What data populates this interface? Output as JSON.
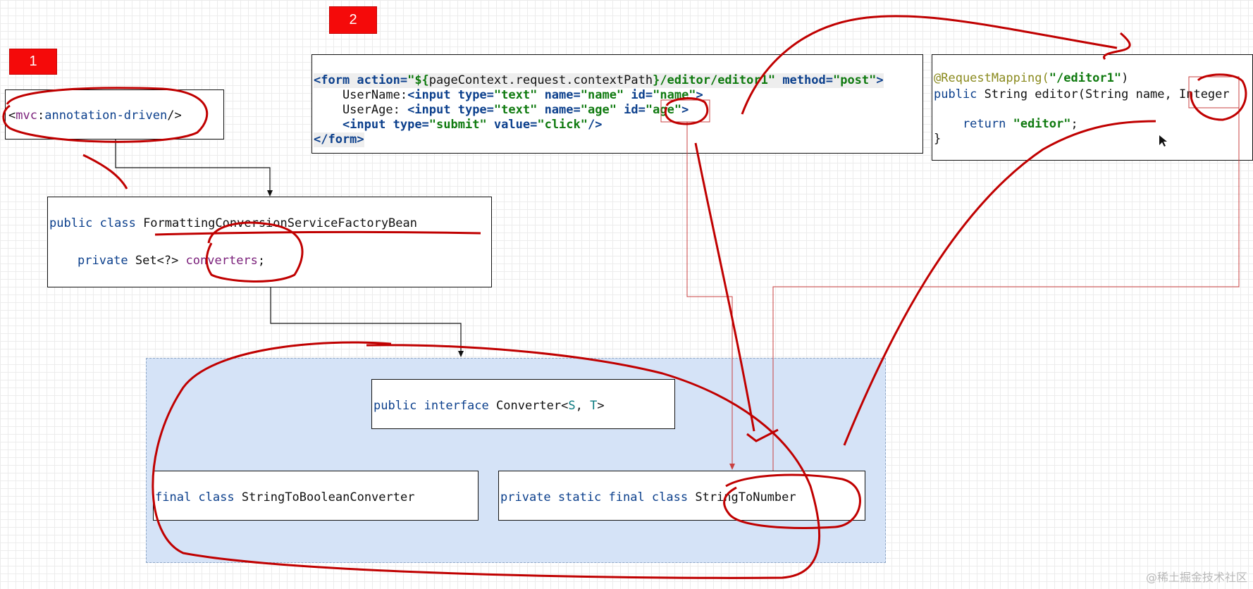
{
  "badges": {
    "one": "1",
    "two": "2"
  },
  "mvc_box": {
    "open": "<",
    "prefix": "mvc",
    "colon": ":",
    "name": "annotation-driven",
    "close": "/>"
  },
  "factory_box": {
    "line1_kw": "public class ",
    "line1_name": "FormattingConversionServiceFactoryBean",
    "line2_kw": "private ",
    "line2_type": "Set<?> ",
    "line2_field": "converters",
    "line2_end": ";"
  },
  "form_box": {
    "l1_open": "<form",
    "l1_attr1": " action=",
    "l1_val1a": "\"${",
    "l1_val1b": "pageContext.request.contextPath",
    "l1_val1c": "}/editor/editor1\"",
    "l1_attr2": " method=",
    "l1_val2": "\"post\"",
    "l1_close": ">",
    "l2_text": "    UserName:",
    "l2_tag": "<input",
    "l2_a1": " type=",
    "l2_v1": "\"text\"",
    "l2_a2": " name=",
    "l2_v2": "\"name\"",
    "l2_a3": " id=",
    "l2_v3": "\"name\"",
    "l2_close": ">",
    "l3_text": "    UserAge: ",
    "l3_tag": "<input",
    "l3_a1": " type=",
    "l3_v1": "\"text\"",
    "l3_a2": " name=",
    "l3_v2": "\"age\"",
    "l3_a3": " id=",
    "l3_v3": "\"age\"",
    "l3_close": ">",
    "l4_indent": "    ",
    "l4_tag": "<input",
    "l4_a1": " type=",
    "l4_v1": "\"submit\"",
    "l4_a2": " value=",
    "l4_v2": "\"click\"",
    "l4_close": "/>",
    "l5": "</form>"
  },
  "controller_box": {
    "l1_anno": "@RequestMapping(",
    "l1_str": "\"/editor1\"",
    "l1_end": ")",
    "l2_kw": "public ",
    "l2_rest": "String editor(String name, Integer",
    "l3_kw": "    return ",
    "l3_str": "\"editor\"",
    "l3_end": ";",
    "l4": "}"
  },
  "converter_box": {
    "kw": "public interface ",
    "name": "Converter<",
    "s": "S",
    "comma": ", ",
    "t": "T",
    "end": ">"
  },
  "bool_box": {
    "kw": "final class ",
    "name": "StringToBooleanConverter"
  },
  "number_box": {
    "kw": "private static final class ",
    "name": "StringToNumber"
  },
  "watermark": "@稀土掘金技术社区",
  "colors": {
    "badge": "#f50a0a",
    "ink": "#c00000",
    "region": "#d5e3f7",
    "keyword": "#0b3f8c",
    "string": "#0f7a0f"
  }
}
